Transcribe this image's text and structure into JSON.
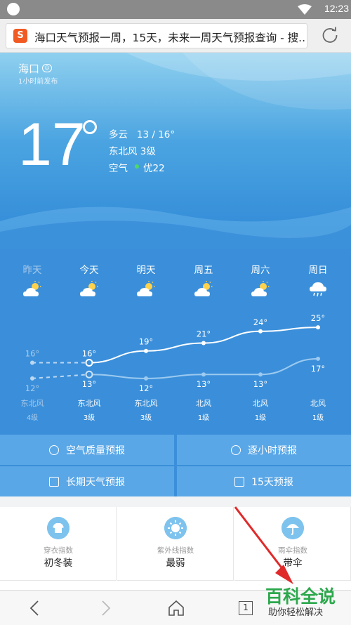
{
  "status_bar": {
    "time": "12:23"
  },
  "address_bar": {
    "site_icon_letter": "S",
    "page_title": "海口天气预报一周，15天，未来一周天气预报查询 - 搜..."
  },
  "current": {
    "city": "海口",
    "city_badge": "☺",
    "published": "1小时前发布",
    "temperature": "17",
    "condition": "多云",
    "range": "13 / 16°",
    "wind": "东北风 3级",
    "air_label": "空气",
    "air_value": "优22",
    "air_color": "#4cd964"
  },
  "forecast": {
    "days": [
      {
        "label": "昨天",
        "icon": "partly-cloudy-icon",
        "high": "16°",
        "low": "12°",
        "wind": "东北风",
        "level": "4级",
        "past": true
      },
      {
        "label": "今天",
        "icon": "partly-cloudy-icon",
        "high": "16°",
        "low": "13°",
        "wind": "东北风",
        "level": "3级",
        "past": false
      },
      {
        "label": "明天",
        "icon": "partly-cloudy-icon",
        "high": "19°",
        "low": "12°",
        "wind": "东北风",
        "level": "3级",
        "past": false
      },
      {
        "label": "周五",
        "icon": "partly-cloudy-icon",
        "high": "21°",
        "low": "13°",
        "wind": "北风",
        "level": "1级",
        "past": false
      },
      {
        "label": "周六",
        "icon": "partly-cloudy-icon",
        "high": "24°",
        "low": "13°",
        "wind": "北风",
        "level": "1级",
        "past": false
      },
      {
        "label": "周日",
        "icon": "rain-cloud-icon",
        "high": "25°",
        "low": "17°",
        "wind": "北风",
        "level": "1级",
        "past": false
      }
    ],
    "high_values": [
      16,
      16,
      19,
      21,
      24,
      25
    ],
    "low_values": [
      12,
      13,
      12,
      13,
      13,
      17
    ]
  },
  "links": {
    "air_quality": "空气质量预报",
    "hourly": "逐小时预报",
    "long_term": "长期天气预报",
    "fifteen_day": "15天预报"
  },
  "indexes": [
    {
      "title": "穿衣指数",
      "value": "初冬装",
      "icon": "shirt-icon"
    },
    {
      "title": "紫外线指数",
      "value": "最弱",
      "icon": "sun-icon"
    },
    {
      "title": "雨伞指数",
      "value": "带伞",
      "icon": "umbrella-icon"
    }
  ],
  "navbar": {
    "tab_count": "1"
  },
  "watermark": {
    "main": "百科全说",
    "sub": "助你轻松解决"
  }
}
